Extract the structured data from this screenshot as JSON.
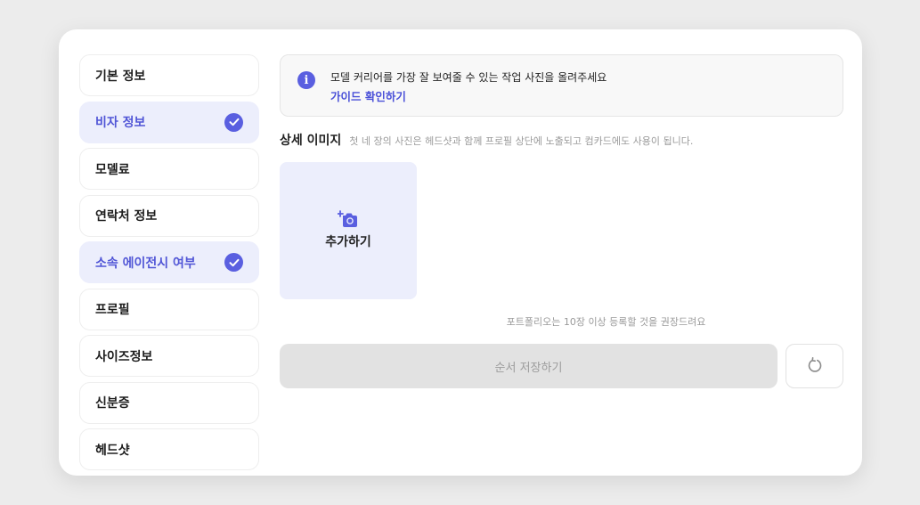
{
  "sidebar": {
    "items": [
      {
        "label": "기본 정보",
        "done": false
      },
      {
        "label": "비자 정보",
        "done": true
      },
      {
        "label": "모델료",
        "done": false
      },
      {
        "label": "연락처 정보",
        "done": false
      },
      {
        "label": "소속 에이전시 여부",
        "done": true
      },
      {
        "label": "프로필",
        "done": false
      },
      {
        "label": "사이즈정보",
        "done": false
      },
      {
        "label": "신분증",
        "done": false
      },
      {
        "label": "헤드샷",
        "done": false
      }
    ]
  },
  "notice": {
    "message": "모델 커리어를 가장 잘 보여줄 수 있는 작업 사진을 올려주세요",
    "guide_link": "가이드 확인하기",
    "icon": "info-icon"
  },
  "section": {
    "title": "상세 이미지",
    "description": "첫 네 장의 사진은 헤드샷과 함께 프로필 상단에 노출되고 컴카드에도 사용이 됩니다."
  },
  "upload": {
    "add_label": "추가하기",
    "icon": "camera-plus-icon"
  },
  "hint": "포트폴리오는 10장 이상 등록할 것을 권장드려요",
  "actions": {
    "save_label": "순서 저장하기",
    "reset_icon": "refresh-icon"
  },
  "colors": {
    "accent": "#5a5fe0",
    "accent_bg": "#eceefc",
    "background": "#ececec"
  }
}
